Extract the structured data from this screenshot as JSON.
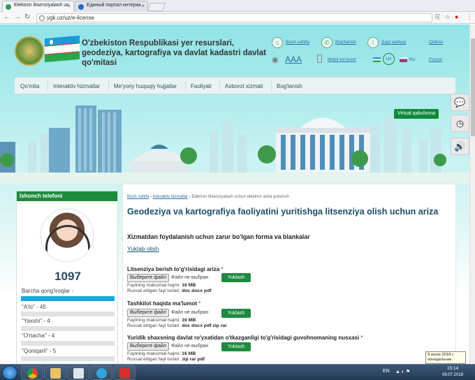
{
  "browser": {
    "tabs": [
      {
        "title": "Elektron litsenziyalash uc",
        "active": true
      },
      {
        "title": "Единый портал интерак",
        "active": false
      }
    ],
    "url": "ygk.uz/uz/e-license"
  },
  "header": {
    "site_title": "O'zbekiston Respublikasi yer resurslari, geodeziya, kartografiya va davlat kadastri davlat qo'mitasi",
    "links": {
      "home": "Bosh sahifa",
      "contact": "Bog'lanish",
      "sitemap": "Sayt xaritasi",
      "search": "Qidiruv",
      "mobile": "Mobil ko'rinish",
      "forum": "Forum",
      "font_size": "AAA"
    },
    "languages": {
      "uz": "Uz",
      "ru": "Ru"
    }
  },
  "nav": {
    "items": [
      "Qo'mita",
      "Interaktiv hizmatlar",
      "Me'yoriy huquqiy hujjatlar",
      "Faoliyati",
      "Axborot xizmati",
      "Bog'lanish"
    ]
  },
  "virtual_button": "Virtual qabulxona",
  "left_panel": {
    "title": "Ishonch telefoni",
    "phone": "1097",
    "poll_question": "Barcha qong'iroqlar -",
    "poll_items": [
      "\"A'lo\" - 45",
      "\"Yaxshi\" - 4",
      "\"O'rtacha\" - 4",
      "\"Qoniqarli\" - 5"
    ]
  },
  "main": {
    "breadcrumb": {
      "home": "Bosh sahifa",
      "section": "Interaktiv hizmatlar",
      "current": "Elektron litsenziyalash uchun elektron ariza yuborish",
      "sep": "›"
    },
    "title": "Geodeziya va kartografiya faoliyatini yuritishga litsenziya olish uchun ariza",
    "subtitle": "Xizmatdan foydalanish uchun zarur bo'lgan forma va blankalar",
    "download_link": "Yuklab olish",
    "file_fields": [
      {
        "label": "Litsenziya berish to'g'risidagi ariza",
        "required": "*",
        "choose": "Выберите файл",
        "no_file": "Файл не выбран",
        "upload": "Yuklash",
        "max_label": "Faylning maksimal hajmi:",
        "max_value": "16 MB",
        "types_label": "Ruxsat etilgan fayl turlari:",
        "types_value": "doc docx pdf"
      },
      {
        "label": "Tashkilot haqida ma'lumot",
        "required": "*",
        "choose": "Выберите файл",
        "no_file": "Файл не выбран",
        "upload": "Yuklash",
        "max_label": "Faylning maksimal hajmi:",
        "max_value": "16 MB",
        "types_label": "Ruxsat etilgan fayl turlari:",
        "types_value": "doc docx pdf zip rar"
      },
      {
        "label": "Yuridik shaxsning davlat ro'yxatidan o'tkazganligi to'g'risidagi guvohnomaning nusxasi",
        "required": "*",
        "choose": "Выберите файл",
        "no_file": "Файл не выбран",
        "upload": "Yuklash",
        "max_label": "Faylning maksimal hajmi:",
        "max_value": "16 MB",
        "types_label": "Ruxsat etilgan fayl turlari:",
        "types_value": "zip rar pdf"
      }
    ]
  },
  "taskbar": {
    "lang": "EN",
    "time": "15:14",
    "date": "09.07.2018",
    "tooltip_date": "9 июля 2018 г.",
    "tooltip_day": "понедельник"
  },
  "colors": {
    "brand_green": "#1e8a3e",
    "link_blue": "#2a6ea8",
    "title_blue": "#1b4d6b"
  }
}
